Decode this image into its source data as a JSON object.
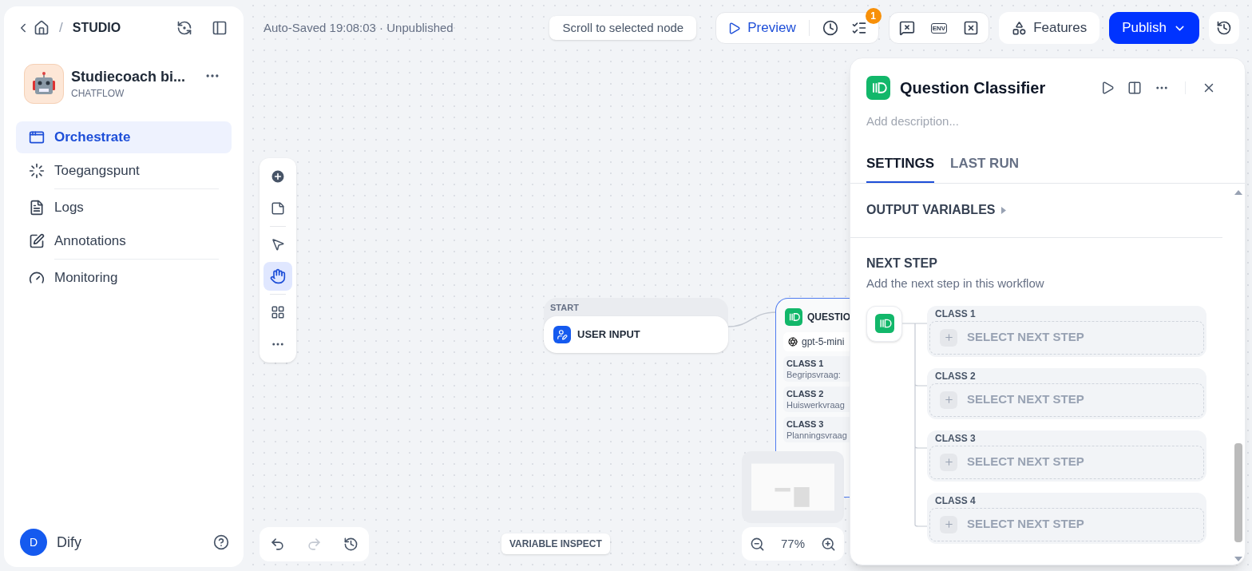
{
  "breadcrumb": {
    "separator": "/",
    "section": "STUDIO"
  },
  "app": {
    "name": "Studiecoach bi...",
    "type": "CHATFLOW"
  },
  "nav": [
    {
      "label": "Orchestrate",
      "selected": true
    },
    {
      "label": "Toegangspunt",
      "selected": false
    },
    {
      "label": "Logs",
      "selected": false
    },
    {
      "label": "Annotations",
      "selected": false
    },
    {
      "label": "Monitoring",
      "selected": false
    }
  ],
  "user": {
    "initial": "D",
    "name": "Dify"
  },
  "status": "Auto-Saved 19:08:03 · Unpublished",
  "toolbar": {
    "scroll_button": "Scroll to selected node",
    "preview": "Preview",
    "badge": "1",
    "env_label": "ENV",
    "features": "Features",
    "publish": "Publish"
  },
  "tools": [
    {
      "selected": false
    },
    {
      "selected": true
    }
  ],
  "canvas": {
    "start_node": {
      "header": "START",
      "title": "USER INPUT"
    },
    "classifier_node": {
      "title": "QUESTIO",
      "model": "gpt-5-mini",
      "classes": [
        {
          "label": "CLASS 1",
          "text": "Begripsvraag:"
        },
        {
          "label": "CLASS 2",
          "text": "Huiswerkvraag"
        },
        {
          "label": "CLASS 3",
          "text": "Planningsvraag"
        }
      ]
    },
    "variable_inspect": "VARIABLE INSPECT",
    "zoom": "77%"
  },
  "panel": {
    "title": "Question Classifier",
    "description_placeholder": "Add description...",
    "tabs": [
      {
        "label": "SETTINGS",
        "selected": true
      },
      {
        "label": "LAST RUN",
        "selected": false
      }
    ],
    "output_variables": "OUTPUT VARIABLES",
    "next_step": {
      "title": "NEXT STEP",
      "subtitle": "Add the next step in this workflow",
      "branches": [
        {
          "label": "CLASS 1",
          "action": "SELECT NEXT STEP"
        },
        {
          "label": "CLASS 2",
          "action": "SELECT NEXT STEP"
        },
        {
          "label": "CLASS 3",
          "action": "SELECT NEXT STEP"
        },
        {
          "label": "CLASS 4",
          "action": "SELECT NEXT STEP"
        }
      ]
    }
  }
}
